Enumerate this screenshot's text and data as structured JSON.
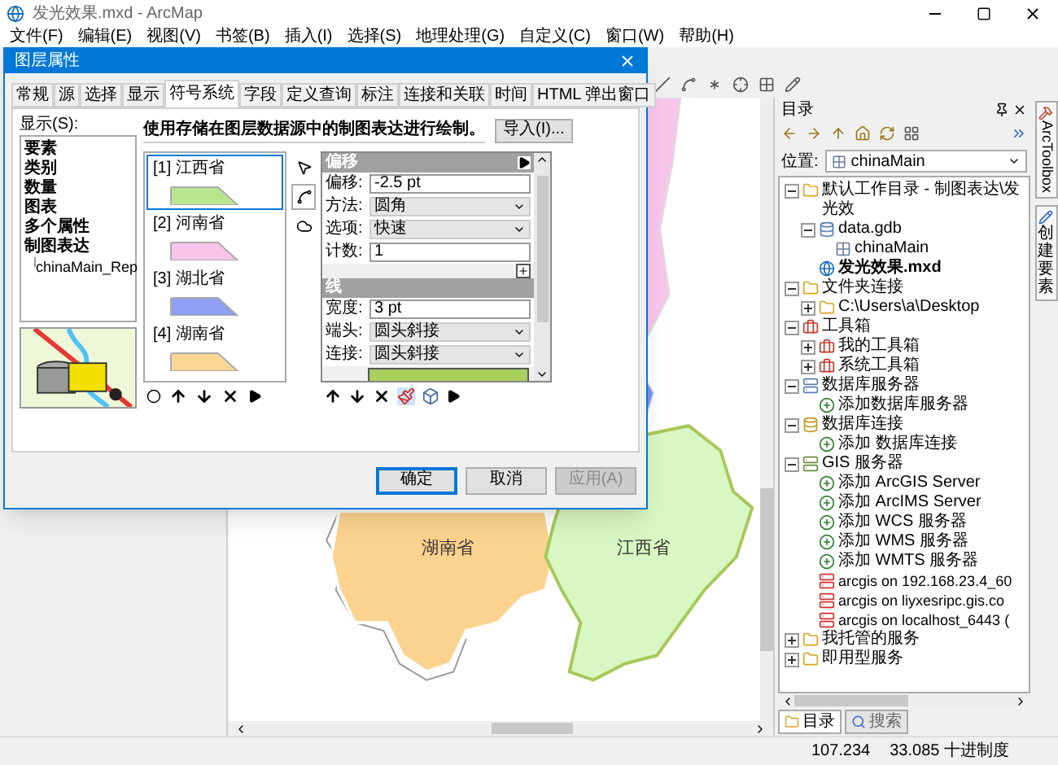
{
  "window": {
    "title": "发光效果.mxd - ArcMap"
  },
  "menu": [
    "文件(F)",
    "编辑(E)",
    "视图(V)",
    "书签(B)",
    "插入(I)",
    "选择(S)",
    "地理处理(G)",
    "自定义(C)",
    "窗口(W)",
    "帮助(H)"
  ],
  "dialog": {
    "title": "图层属性",
    "tabs": [
      {
        "label": "常规",
        "selected": false
      },
      {
        "label": "源",
        "selected": false
      },
      {
        "label": "选择",
        "selected": false
      },
      {
        "label": "显示",
        "selected": false
      },
      {
        "label": "符号系统",
        "selected": true
      },
      {
        "label": "字段",
        "selected": false
      },
      {
        "label": "定义查询",
        "selected": false
      },
      {
        "label": "标注",
        "selected": false
      },
      {
        "label": "连接和关联",
        "selected": false
      },
      {
        "label": "时间",
        "selected": false
      },
      {
        "label": "HTML 弹出窗口",
        "selected": false
      }
    ],
    "show_label": "显示(S):",
    "renderers": [
      {
        "label": "要素"
      },
      {
        "label": "类别"
      },
      {
        "label": "数量"
      },
      {
        "label": "图表"
      },
      {
        "label": "多个属性"
      },
      {
        "label": "制图表达",
        "children": [
          {
            "label": "chinaMain_Rep"
          }
        ]
      }
    ],
    "description": "使用存储在图层数据源中的制图表达进行绘制。",
    "import_button": "导入(I)...",
    "rules": [
      {
        "label": "[1] 江西省",
        "color": "#b9e58e",
        "selected": true
      },
      {
        "label": "[2] 河南省",
        "color": "#f9c3ea",
        "selected": false
      },
      {
        "label": "[3] 湖北省",
        "color": "#8f9ff2",
        "selected": false
      },
      {
        "label": "[4] 湖南省",
        "color": "#fcd694",
        "selected": false
      }
    ],
    "effect_tools": [
      {
        "kind": "select",
        "selected": false
      },
      {
        "kind": "line",
        "selected": true
      },
      {
        "kind": "fill",
        "selected": false
      }
    ],
    "property_groups": [
      {
        "title": "偏移",
        "rows": [
          {
            "kind": "text",
            "label": "偏移:",
            "value": "-2.5 pt"
          },
          {
            "kind": "select",
            "label": "方法:",
            "value": "圆角"
          },
          {
            "kind": "select",
            "label": "选项:",
            "value": "快速"
          },
          {
            "kind": "text",
            "label": "计数:",
            "value": "1"
          }
        ]
      },
      {
        "title": "线",
        "rows": [
          {
            "kind": "text",
            "label": "宽度:",
            "value": "3 pt"
          },
          {
            "kind": "select",
            "label": "端头:",
            "value": "圆头斜接"
          },
          {
            "kind": "select",
            "label": "连接:",
            "value": "圆头斜接"
          },
          {
            "kind": "color",
            "color": "#a9cf5c"
          }
        ]
      }
    ],
    "buttons": [
      {
        "label": "确定",
        "default": true,
        "disabled": false
      },
      {
        "label": "取消",
        "default": false,
        "disabled": false
      },
      {
        "label": "应用(A)",
        "default": false,
        "disabled": true
      }
    ]
  },
  "map": {
    "labels": [
      "湖南省",
      "江西省"
    ]
  },
  "catalog": {
    "title": "目录",
    "location_label": "位置:",
    "location": "chinaMain",
    "tree": [
      {
        "label": "默认工作目录 - 制图表达\\发光效",
        "kind": "workdir",
        "expanded": true,
        "children": [
          {
            "label": "data.gdb",
            "kind": "gdb",
            "expanded": true,
            "children": [
              {
                "label": "chinaMain",
                "kind": "feature"
              }
            ]
          },
          {
            "label": "发光效果.mxd",
            "kind": "map"
          }
        ]
      },
      {
        "label": "文件夹连接",
        "kind": "folder",
        "expanded": true,
        "children": [
          {
            "label": "C:\\Users\\a\\Desktop",
            "kind": "folder",
            "expanded": false
          }
        ]
      },
      {
        "label": "工具箱",
        "kind": "toolbox",
        "expanded": true,
        "children": [
          {
            "label": "我的工具箱",
            "kind": "toolbox",
            "expanded": false
          },
          {
            "label": "系统工具箱",
            "kind": "toolbox",
            "expanded": false
          }
        ]
      },
      {
        "label": "数据库服务器",
        "kind": "dbserver",
        "expanded": true,
        "children": [
          {
            "label": "添加数据库服务器",
            "kind": "add"
          }
        ]
      },
      {
        "label": "数据库连接",
        "kind": "dbconn",
        "expanded": true,
        "children": [
          {
            "label": "添加 数据库连接",
            "kind": "add"
          }
        ]
      },
      {
        "label": "GIS 服务器",
        "kind": "server",
        "expanded": true,
        "children": [
          {
            "label": "添加 ArcGIS Server",
            "kind": "add"
          },
          {
            "label": "添加 ArcIMS Server",
            "kind": "add"
          },
          {
            "label": "添加 WCS 服务器",
            "kind": "add"
          },
          {
            "label": "添加 WMS 服务器",
            "kind": "add"
          },
          {
            "label": "添加 WMTS 服务器",
            "kind": "add"
          },
          {
            "label": "arcgis on 192.168.23.4_60",
            "kind": "arcgis"
          },
          {
            "label": "arcgis on liyxesripc.gis.co",
            "kind": "arcgis"
          },
          {
            "label": "arcgis on localhost_6443 (",
            "kind": "arcgis"
          }
        ]
      },
      {
        "label": "我托管的服务",
        "kind": "folder",
        "expanded": false
      },
      {
        "label": "即用型服务",
        "kind": "folder",
        "expanded": false
      }
    ],
    "bottom_tabs": [
      {
        "label": "目录",
        "selected": true
      },
      {
        "label": "搜索",
        "selected": false
      }
    ]
  },
  "side_tabs": [
    "ArcToolbox",
    "创建要素"
  ],
  "status_bar": [
    "107.234",
    "33.085 十进制度"
  ]
}
